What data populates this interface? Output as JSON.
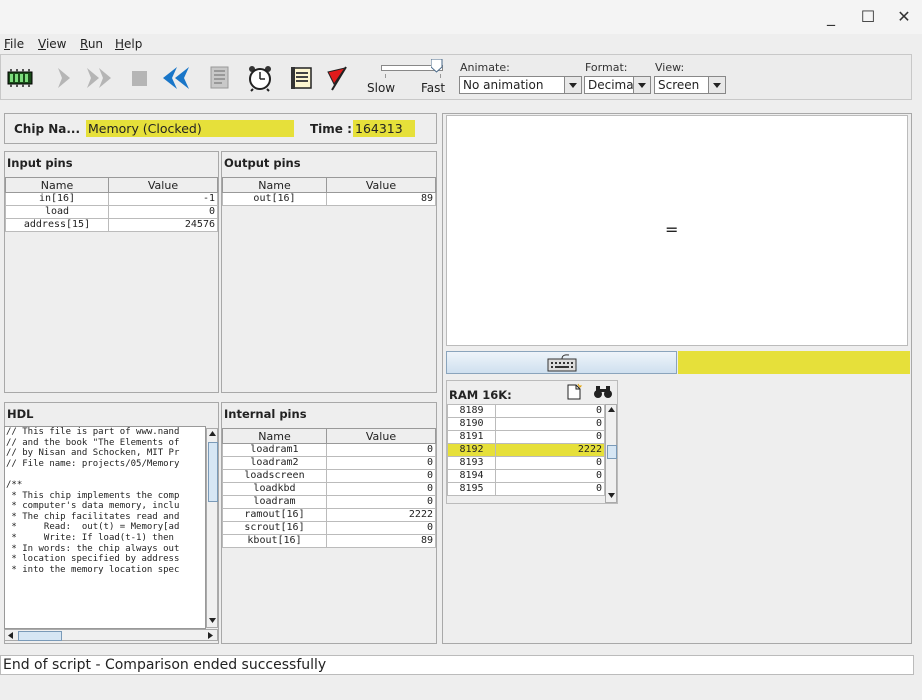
{
  "window": {
    "minimize": "_",
    "maximize": "☐",
    "close": "✕"
  },
  "menu": [
    {
      "label": "File",
      "mnemonic": "F",
      "rest": "ile"
    },
    {
      "label": "View",
      "mnemonic": "V",
      "rest": "iew"
    },
    {
      "label": "Run",
      "mnemonic": "R",
      "rest": "un"
    },
    {
      "label": "Help",
      "mnemonic": "H",
      "rest": "elp"
    }
  ],
  "toolbar": {
    "icons": [
      "chip-load-icon",
      "single-step-icon",
      "fast-forward-icon",
      "stop-icon",
      "rewind-icon",
      "script-icon",
      "clock-icon",
      "breakpoint-icon",
      "flag-icon"
    ],
    "speed_slow": "Slow",
    "speed_fast": "Fast",
    "speed_level": 1.0,
    "animate_label": "Animate:",
    "animate_value": "No animation",
    "format_label": "Format:",
    "format_value": "Decimal",
    "view_label": "View:",
    "view_value": "Screen"
  },
  "chip": {
    "name_label": "Chip Na...",
    "name_value": "Memory (Clocked)",
    "time_label": "Time :",
    "time_value": "164313"
  },
  "input_pins": {
    "title": "Input pins",
    "col_name": "Name",
    "col_value": "Value",
    "rows": [
      {
        "name": "in[16]",
        "value": "-1"
      },
      {
        "name": "load",
        "value": "0"
      },
      {
        "name": "address[15]",
        "value": "24576"
      }
    ]
  },
  "output_pins": {
    "title": "Output pins",
    "col_name": "Name",
    "col_value": "Value",
    "rows": [
      {
        "name": "out[16]",
        "value": "89"
      }
    ]
  },
  "hdl": {
    "title": "HDL",
    "lines": [
      "// This file is part of www.nand",
      "// and the book \"The Elements of",
      "// by Nisan and Schocken, MIT Pr",
      "// File name: projects/05/Memory",
      "",
      "/**",
      " * This chip implements the comp",
      " * computer's data memory, inclu",
      " * The chip facilitates read and",
      " *     Read:  out(t) = Memory[ad",
      " *     Write: If load(t-1) then ",
      " * In words: the chip always out",
      " * location specified by address",
      " * into the memory location spec"
    ]
  },
  "internal_pins": {
    "title": "Internal pins",
    "col_name": "Name",
    "col_value": "Value",
    "rows": [
      {
        "name": "loadram1",
        "value": "0"
      },
      {
        "name": "loadram2",
        "value": "0"
      },
      {
        "name": "loadscreen",
        "value": "0"
      },
      {
        "name": "loadkbd",
        "value": "0"
      },
      {
        "name": "loadram",
        "value": "0"
      },
      {
        "name": "ramout[16]",
        "value": "2222"
      },
      {
        "name": "scrout[16]",
        "value": "0"
      },
      {
        "name": "kbout[16]",
        "value": "89"
      }
    ]
  },
  "screen": {
    "char_shown": "="
  },
  "ram": {
    "title": "RAM 16K:",
    "rows": [
      {
        "addr": "8189",
        "value": "0"
      },
      {
        "addr": "8190",
        "value": "0"
      },
      {
        "addr": "8191",
        "value": "0"
      },
      {
        "addr": "8192",
        "value": "2222"
      },
      {
        "addr": "8193",
        "value": "0"
      },
      {
        "addr": "8194",
        "value": "0"
      },
      {
        "addr": "8195",
        "value": "0"
      }
    ],
    "highlight_index": 3
  },
  "status": {
    "message": "End of script - Comparison ended successfully"
  },
  "colors": {
    "highlight": "#e6e03a",
    "panel_bg": "#eeeeee",
    "field_bg": "#ffffff"
  }
}
